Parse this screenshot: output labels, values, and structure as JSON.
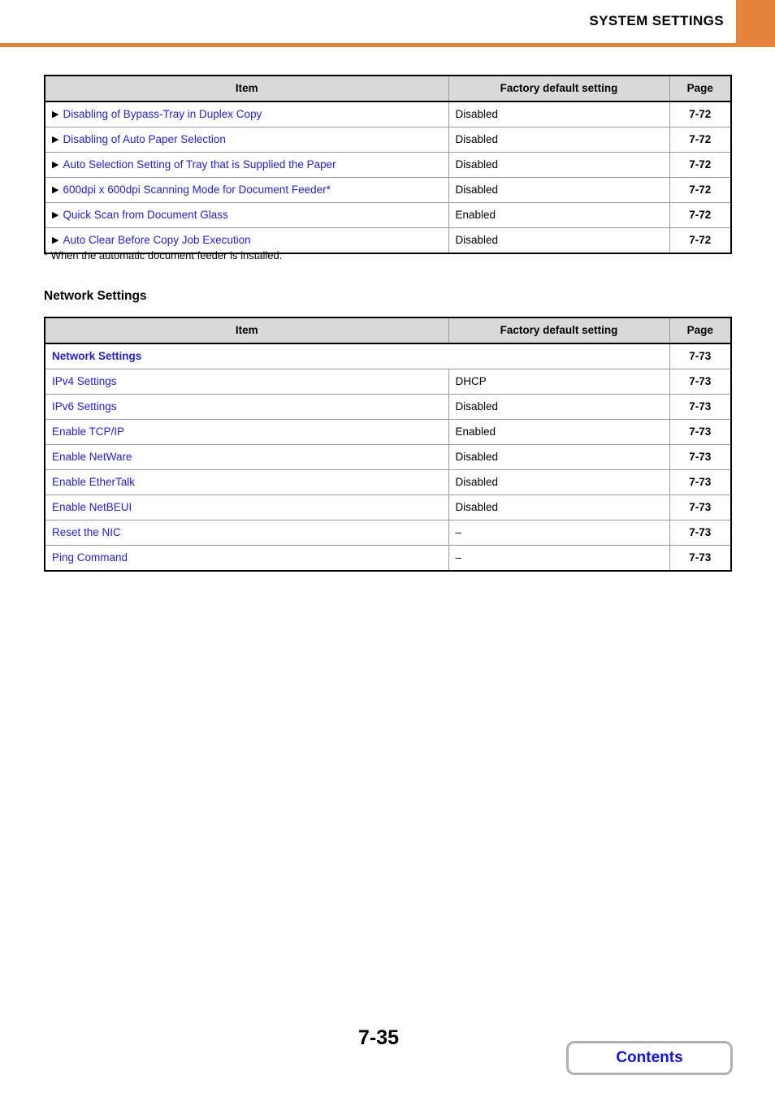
{
  "header": {
    "title": "SYSTEM SETTINGS",
    "accent_color": "#e5833a"
  },
  "colors": {
    "link_blue": "#2222dd",
    "page_blue": "#2222cc",
    "table_header_gray": "#d9d9d9",
    "orange": "#e5833a",
    "button_border_gray": "#b0b0b0"
  },
  "table_headers": {
    "item": "Item",
    "default": "Factory default setting",
    "page": "Page"
  },
  "table_one": {
    "rows": [
      {
        "arrow": "▶",
        "item": "Disabling of Bypass-Tray in Duplex Copy",
        "default": "Disabled",
        "page": "7-72"
      },
      {
        "arrow": "▶",
        "item": "Disabling of Auto Paper Selection",
        "default": "Disabled",
        "page": "7-72"
      },
      {
        "arrow": "▶",
        "item": "Auto Selection Setting of Tray that is Supplied the Paper",
        "default": "Disabled",
        "page": "7-72"
      },
      {
        "arrow": "▶",
        "item": "600dpi x 600dpi Scanning Mode for Document Feeder*",
        "default": "Disabled",
        "page": "7-72"
      },
      {
        "arrow": "▶",
        "item": "Quick Scan from Document Glass",
        "default": "Enabled",
        "page": "7-72"
      },
      {
        "arrow": "▶",
        "item": "Auto Clear Before Copy Job Execution",
        "default": "Disabled",
        "page": "7-72"
      }
    ]
  },
  "footnote": "* When the automatic document feeder is installed.",
  "section_heading": "Network Settings",
  "table_two": {
    "group_row": {
      "item": "Network Settings",
      "page": "7-73"
    },
    "rows": [
      {
        "item": "IPv4 Settings",
        "default": "DHCP",
        "page": "7-73"
      },
      {
        "item": "IPv6 Settings",
        "default": "Disabled",
        "page": "7-73"
      },
      {
        "item": "Enable TCP/IP",
        "default": "Enabled",
        "page": "7-73"
      },
      {
        "item": "Enable NetWare",
        "default": "Disabled",
        "page": "7-73"
      },
      {
        "item": "Enable EtherTalk",
        "default": "Disabled",
        "page": "7-73"
      },
      {
        "item": "Enable NetBEUI",
        "default": "Disabled",
        "page": "7-73"
      },
      {
        "item": "Reset the NIC",
        "default": "–",
        "page": "7-73"
      },
      {
        "item": "Ping Command",
        "default": "–",
        "page": "7-73"
      }
    ]
  },
  "footer": {
    "page_number": "7-35",
    "contents_label": "Contents"
  }
}
